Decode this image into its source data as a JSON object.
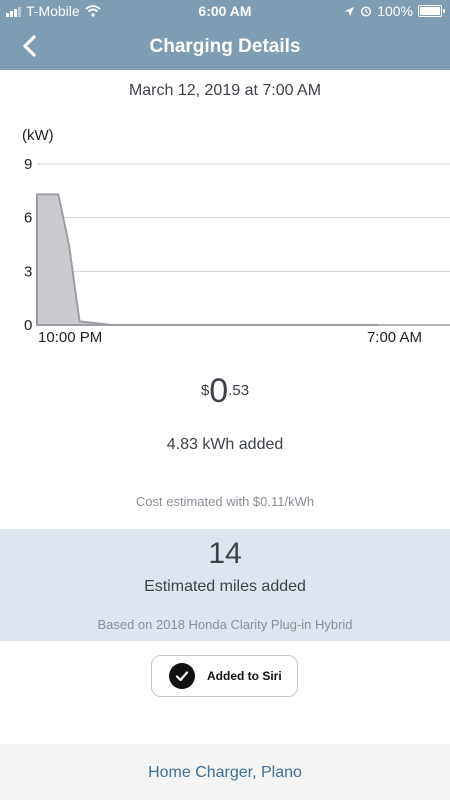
{
  "status_bar": {
    "carrier": "T-Mobile",
    "time": "6:00 AM",
    "battery": "100%",
    "battery_level": 1.0
  },
  "nav": {
    "title": "Charging Details"
  },
  "session": {
    "date": "March 12, 2019 at 7:00 AM",
    "cost_symbol": "$",
    "cost_whole": "0",
    "cost_cents": ".53",
    "energy_added": "4.83 kWh added",
    "rate_note": "Cost estimated with $0.11/kWh"
  },
  "miles": {
    "value": "14",
    "label": "Estimated miles added",
    "note": "Based on 2018 Honda Clarity Plug-in Hybrid"
  },
  "siri": {
    "label": "Added to Siri"
  },
  "footer": {
    "location": "Home Charger, Plano"
  },
  "colors": {
    "header_bg": "#7d9db5",
    "area_fill": "#cbcbcf",
    "area_stroke": "#9c9ca4",
    "link": "#3f6f96",
    "panel_bg": "#dde6ef"
  },
  "chart_data": {
    "type": "area",
    "ylabel": "(kW)",
    "yticks": [
      "0",
      "3",
      "6",
      "9"
    ],
    "ylim": [
      0,
      9
    ],
    "xtick_labels": [
      "10:00 PM",
      "7:00 AM"
    ],
    "x_hours": [
      0,
      0.25,
      0.5,
      0.75,
      1.0,
      1.75,
      8.0
    ],
    "values": [
      7.3,
      7.3,
      7.3,
      4.5,
      0.2,
      0.0,
      0.0
    ],
    "grid": true
  }
}
